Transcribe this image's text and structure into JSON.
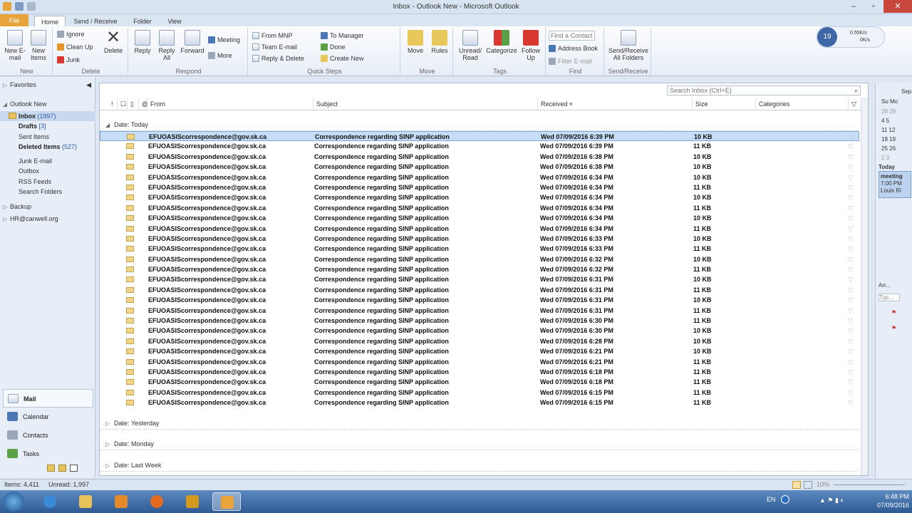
{
  "window": {
    "title": "Inbox - Outlook New - Microsoft Outlook"
  },
  "tabs": [
    "File",
    "Home",
    "Send / Receive",
    "Folder",
    "View"
  ],
  "ribbon": {
    "new": {
      "new_email": "New E-mail",
      "new_items": "New Items",
      "label": "New"
    },
    "delete": {
      "ignore": "Ignore",
      "clean_up": "Clean Up",
      "junk": "Junk",
      "delete": "Delete",
      "label": "Delete"
    },
    "respond": {
      "reply": "Reply",
      "reply_all": "Reply All",
      "forward": "Forward",
      "meeting": "Meeting",
      "more": "More",
      "label": "Respond"
    },
    "quick_steps": {
      "items": [
        "From MNP",
        "Team E-mail",
        "Reply & Delete",
        "To Manager",
        "Done",
        "Create New"
      ],
      "label": "Quick Steps"
    },
    "move": {
      "move": "Move",
      "rules": "Rules",
      "label": "Move"
    },
    "tags": {
      "unread_read": "Unread/ Read",
      "categorize": "Categorize",
      "follow_up": "Follow Up",
      "label": "Tags"
    },
    "find": {
      "find_contact": "Find a Contact",
      "address_book": "Address Book",
      "filter_email": "Filter E-mail",
      "label": "Find"
    },
    "send_receive": {
      "button": "Send/Receive All Folders",
      "label": "Send/Receive"
    }
  },
  "net_widget": {
    "count": "19",
    "up": "0.55K/s",
    "down": "0K/s"
  },
  "nav": {
    "favorites": "Favorites",
    "account": "Outlook New",
    "folders": [
      {
        "name": "Inbox",
        "count": "(1997)"
      },
      {
        "name": "Drafts",
        "count": "[3]"
      },
      {
        "name": "Sent Items",
        "count": ""
      },
      {
        "name": "Deleted Items",
        "count": "(527)"
      },
      {
        "name": "Junk E-mail",
        "count": ""
      },
      {
        "name": "Outbox",
        "count": ""
      },
      {
        "name": "RSS Feeds",
        "count": ""
      },
      {
        "name": "Search Folders",
        "count": ""
      }
    ],
    "backup": "Backup",
    "hr": "HR@canwell.org",
    "modules": [
      "Mail",
      "Calendar",
      "Contacts",
      "Tasks"
    ]
  },
  "list": {
    "search_placeholder": "Search Inbox (Ctrl+E)",
    "columns": {
      "from": "From",
      "subject": "Subject",
      "received": "Received",
      "size": "Size",
      "categories": "Categories"
    },
    "group_today": "Date: Today",
    "group_yesterday": "Date: Yesterday",
    "group_monday": "Date: Monday",
    "group_lastweek": "Date: Last Week",
    "rows": [
      {
        "from": "EFUOASIScorrespondence@gov.sk.ca",
        "subject": "Correspondence regarding SINP application",
        "received": "Wed 07/09/2016 6:39 PM",
        "size": "10 KB"
      },
      {
        "from": "EFUOASIScorrespondence@gov.sk.ca",
        "subject": "Correspondence regarding SINP application",
        "received": "Wed 07/09/2016 6:39 PM",
        "size": "11 KB"
      },
      {
        "from": "EFUOASIScorrespondence@gov.sk.ca",
        "subject": "Correspondence regarding SINP application",
        "received": "Wed 07/09/2016 6:38 PM",
        "size": "10 KB"
      },
      {
        "from": "EFUOASIScorrespondence@gov.sk.ca",
        "subject": "Correspondence regarding SINP application",
        "received": "Wed 07/09/2016 6:38 PM",
        "size": "10 KB"
      },
      {
        "from": "EFUOASIScorrespondence@gov.sk.ca",
        "subject": "Correspondence regarding SINP application",
        "received": "Wed 07/09/2016 6:34 PM",
        "size": "10 KB"
      },
      {
        "from": "EFUOASIScorrespondence@gov.sk.ca",
        "subject": "Correspondence regarding SINP application",
        "received": "Wed 07/09/2016 6:34 PM",
        "size": "11 KB"
      },
      {
        "from": "EFUOASIScorrespondence@gov.sk.ca",
        "subject": "Correspondence regarding SINP application",
        "received": "Wed 07/09/2016 6:34 PM",
        "size": "10 KB"
      },
      {
        "from": "EFUOASIScorrespondence@gov.sk.ca",
        "subject": "Correspondence regarding SINP application",
        "received": "Wed 07/09/2016 6:34 PM",
        "size": "11 KB"
      },
      {
        "from": "EFUOASIScorrespondence@gov.sk.ca",
        "subject": "Correspondence regarding SINP application",
        "received": "Wed 07/09/2016 6:34 PM",
        "size": "10 KB"
      },
      {
        "from": "EFUOASIScorrespondence@gov.sk.ca",
        "subject": "Correspondence regarding SINP application",
        "received": "Wed 07/09/2016 6:34 PM",
        "size": "11 KB"
      },
      {
        "from": "EFUOASIScorrespondence@gov.sk.ca",
        "subject": "Correspondence regarding SINP application",
        "received": "Wed 07/09/2016 6:33 PM",
        "size": "10 KB"
      },
      {
        "from": "EFUOASIScorrespondence@gov.sk.ca",
        "subject": "Correspondence regarding SINP application",
        "received": "Wed 07/09/2016 6:33 PM",
        "size": "11 KB"
      },
      {
        "from": "EFUOASIScorrespondence@gov.sk.ca",
        "subject": "Correspondence regarding SINP application",
        "received": "Wed 07/09/2016 6:32 PM",
        "size": "10 KB"
      },
      {
        "from": "EFUOASIScorrespondence@gov.sk.ca",
        "subject": "Correspondence regarding SINP application",
        "received": "Wed 07/09/2016 6:32 PM",
        "size": "11 KB"
      },
      {
        "from": "EFUOASIScorrespondence@gov.sk.ca",
        "subject": "Correspondence regarding SINP application",
        "received": "Wed 07/09/2016 6:31 PM",
        "size": "10 KB"
      },
      {
        "from": "EFUOASIScorrespondence@gov.sk.ca",
        "subject": "Correspondence regarding SINP application",
        "received": "Wed 07/09/2016 6:31 PM",
        "size": "11 KB"
      },
      {
        "from": "EFUOASIScorrespondence@gov.sk.ca",
        "subject": "Correspondence regarding SINP application",
        "received": "Wed 07/09/2016 6:31 PM",
        "size": "10 KB"
      },
      {
        "from": "EFUOASIScorrespondence@gov.sk.ca",
        "subject": "Correspondence regarding SINP application",
        "received": "Wed 07/09/2016 6:31 PM",
        "size": "11 KB"
      },
      {
        "from": "EFUOASIScorrespondence@gov.sk.ca",
        "subject": "Correspondence regarding SINP application",
        "received": "Wed 07/09/2016 6:30 PM",
        "size": "11 KB"
      },
      {
        "from": "EFUOASIScorrespondence@gov.sk.ca",
        "subject": "Correspondence regarding SINP application",
        "received": "Wed 07/09/2016 6:30 PM",
        "size": "10 KB"
      },
      {
        "from": "EFUOASIScorrespondence@gov.sk.ca",
        "subject": "Correspondence regarding SINP application",
        "received": "Wed 07/09/2016 6:28 PM",
        "size": "10 KB"
      },
      {
        "from": "EFUOASIScorrespondence@gov.sk.ca",
        "subject": "Correspondence regarding SINP application",
        "received": "Wed 07/09/2016 6:21 PM",
        "size": "10 KB"
      },
      {
        "from": "EFUOASIScorrespondence@gov.sk.ca",
        "subject": "Correspondence regarding SINP application",
        "received": "Wed 07/09/2016 6:21 PM",
        "size": "11 KB"
      },
      {
        "from": "EFUOASIScorrespondence@gov.sk.ca",
        "subject": "Correspondence regarding SINP application",
        "received": "Wed 07/09/2016 6:18 PM",
        "size": "11 KB"
      },
      {
        "from": "EFUOASIScorrespondence@gov.sk.ca",
        "subject": "Correspondence regarding SINP application",
        "received": "Wed 07/09/2016 6:18 PM",
        "size": "11 KB"
      },
      {
        "from": "EFUOASIScorrespondence@gov.sk.ca",
        "subject": "Correspondence regarding SINP application",
        "received": "Wed 07/09/2016 6:15 PM",
        "size": "11 KB"
      },
      {
        "from": "EFUOASIScorrespondence@gov.sk.ca",
        "subject": "Correspondence regarding SINP application",
        "received": "Wed 07/09/2016 6:15 PM",
        "size": "11 KB"
      }
    ]
  },
  "todo": {
    "month": "Sep",
    "days_header": "Su Mo",
    "weeks": [
      "28 29",
      "4 5",
      "11 12",
      "18 19",
      "25 26",
      "2 3"
    ],
    "today": "Today",
    "appt": {
      "title": "meeting",
      "time": "7:00 PM",
      "who": "Louis Ri"
    },
    "arrange": "Arr...",
    "type": "Typ..."
  },
  "status": {
    "items": "Items: 4,411",
    "unread": "Unread: 1,997",
    "zoom": "10%"
  },
  "taskbar": {
    "lang": "EN",
    "time": "6:48 PM",
    "date": "07/09/2016"
  }
}
